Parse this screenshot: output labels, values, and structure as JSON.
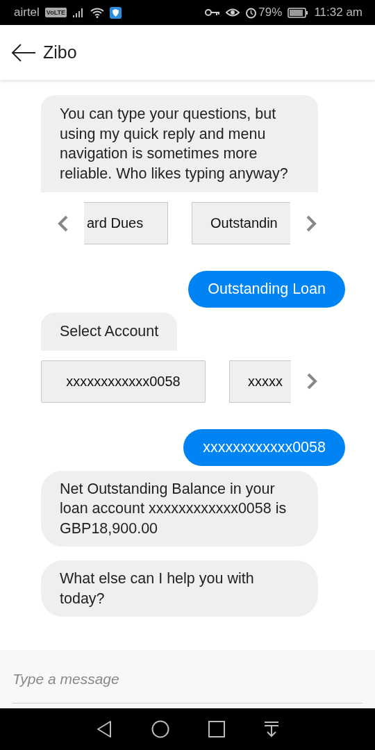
{
  "status_bar": {
    "carrier": "airtel",
    "network_badge": "VoLTE",
    "battery": "79%",
    "time": "11:32 am"
  },
  "header": {
    "title": "Zibo"
  },
  "messages": [
    {
      "kind": "bot",
      "text": "You can type your questions, but using my quick reply and menu navigation is sometimes more reliable. Who likes typing anyway?",
      "attached": true
    },
    {
      "kind": "carousel",
      "has_prev": true,
      "has_next": true,
      "chips": [
        {
          "label": "ard Dues",
          "clipped_left": true,
          "clipped_right": false
        },
        {
          "label": "Outstandin",
          "clipped_left": false,
          "clipped_right": true
        }
      ]
    },
    {
      "kind": "user",
      "text": "Outstanding Loan"
    },
    {
      "kind": "bot",
      "text": "Select Account",
      "attached": true
    },
    {
      "kind": "carousel",
      "has_prev": false,
      "has_next": true,
      "chips": [
        {
          "label": "xxxxxxxxxxxx0058",
          "clipped_left": false,
          "clipped_right": false
        },
        {
          "label": "xxxxx",
          "clipped_left": false,
          "clipped_right": true
        }
      ]
    },
    {
      "kind": "user",
      "text": "xxxxxxxxxxxx0058"
    },
    {
      "kind": "bot",
      "text": "Net Outstanding Balance in your loan account xxxxxxxxxxxx0058 is GBP18,900.00",
      "attached": false
    },
    {
      "kind": "bot",
      "text": "What else can I help you with today?",
      "attached": false
    }
  ],
  "composer": {
    "placeholder": "Type a message"
  }
}
